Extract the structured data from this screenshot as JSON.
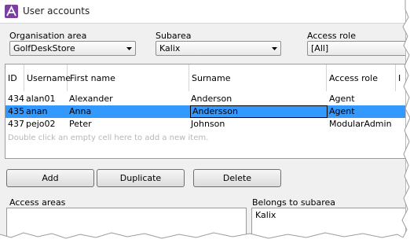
{
  "window": {
    "title": "User accounts"
  },
  "filters": {
    "organisation_area": {
      "label": "Organisation area",
      "value": "GolfDeskStore"
    },
    "subarea": {
      "label": "Subarea",
      "value": "Kalix"
    },
    "access_role": {
      "label": "Access role",
      "value": "[All]"
    }
  },
  "grid": {
    "columns": [
      "ID",
      "Username",
      "First name",
      "Surname",
      "Access role",
      "I"
    ],
    "rows": [
      {
        "id": "434",
        "username": "alan01",
        "first_name": "Alexander",
        "surname": "Anderson",
        "access_role": "Agent",
        "selected": false
      },
      {
        "id": "435",
        "username": "anan",
        "first_name": "Anna",
        "surname": "Andersson",
        "access_role": "Agent",
        "selected": true
      },
      {
        "id": "437",
        "username": "pejo02",
        "first_name": "Peter",
        "surname": "Johnson",
        "access_role": "ModularAdmin",
        "selected": false
      }
    ],
    "empty_hint": "Double click an empty cell here to add a new item."
  },
  "buttons": {
    "add": "Add",
    "duplicate": "Duplicate",
    "delete": "Delete"
  },
  "access_areas": {
    "label": "Access areas",
    "items": []
  },
  "belongs_to_subarea": {
    "label": "Belongs to subarea",
    "items": [
      "Kalix"
    ]
  },
  "colors": {
    "selection": "#3399ff",
    "window_bg": "#f0f0f0",
    "app_icon": "#7a3fa0"
  },
  "icons": {
    "app": "app-logo-icon",
    "dropdown": "chevron-down-icon"
  }
}
